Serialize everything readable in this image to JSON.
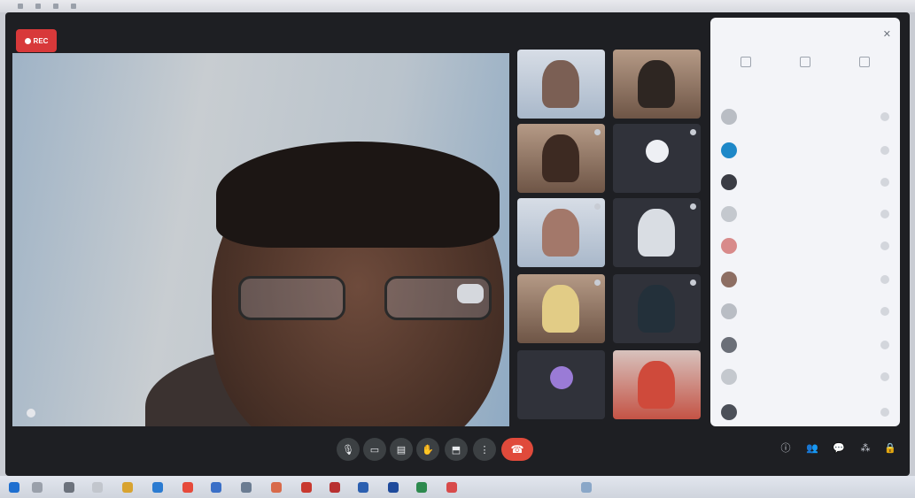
{
  "meeting": {
    "rec_label": "REC",
    "title": "",
    "clock": "",
    "bottom_title": "",
    "main_speaker_name": ""
  },
  "participants": [
    {
      "label": "",
      "avatar_letter": ""
    },
    {
      "label": "",
      "avatar_letter": ""
    },
    {
      "label": "",
      "avatar_letter": ""
    },
    {
      "label": "",
      "avatar_letter": ""
    },
    {
      "label": "",
      "avatar_letter": ""
    },
    {
      "label": "",
      "avatar_letter": ""
    },
    {
      "label": "",
      "avatar_letter": ""
    },
    {
      "label": "",
      "avatar_letter": ""
    },
    {
      "label": "",
      "avatar_letter": ""
    },
    {
      "label": "",
      "avatar_letter": ""
    }
  ],
  "people_panel": {
    "title": "",
    "tabs": [
      "",
      "",
      ""
    ],
    "people": [
      "",
      "",
      "",
      "",
      "",
      "",
      "",
      "",
      "",
      ""
    ]
  },
  "controls": {
    "close_glyph": "✕",
    "mic_glyph": "🎙",
    "camera_glyph": "▭",
    "captions_glyph": "▤",
    "raise_hand_glyph": "✋",
    "present_glyph": "⬒",
    "more_glyph": "⋮",
    "end_call_glyph": "☎",
    "info_glyph": "ⓘ",
    "people_glyph": "👥",
    "chat_glyph": "💬",
    "activities_glyph": "⁂",
    "host_glyph": "🔒"
  },
  "colors": {
    "end_call": "#e04a3b",
    "rec": "#d8393a"
  }
}
